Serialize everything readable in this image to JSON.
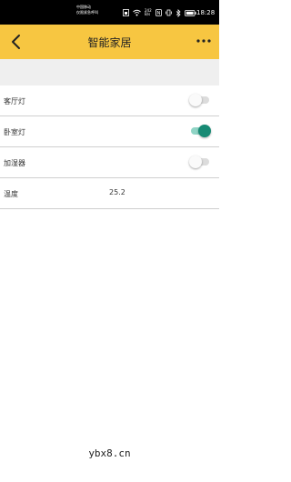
{
  "status_bar": {
    "carrier_line1": "中国移动",
    "carrier_line2": "仅限紧急呼叫",
    "network_speed": "242\nB/s",
    "time": "18:28"
  },
  "app_bar": {
    "title": "智能家居",
    "accent_color": "#f7c641",
    "back_icon": "chevron-left-icon",
    "more_icon": "more-dots-icon"
  },
  "devices": [
    {
      "label": "客厅灯",
      "on": false
    },
    {
      "label": "卧室灯",
      "on": true
    },
    {
      "label": "加湿器",
      "on": false
    }
  ],
  "temperature": {
    "label": "温度",
    "value": "25.2"
  },
  "switch_on_color": "#178a74",
  "watermark": "ybx8.cn"
}
